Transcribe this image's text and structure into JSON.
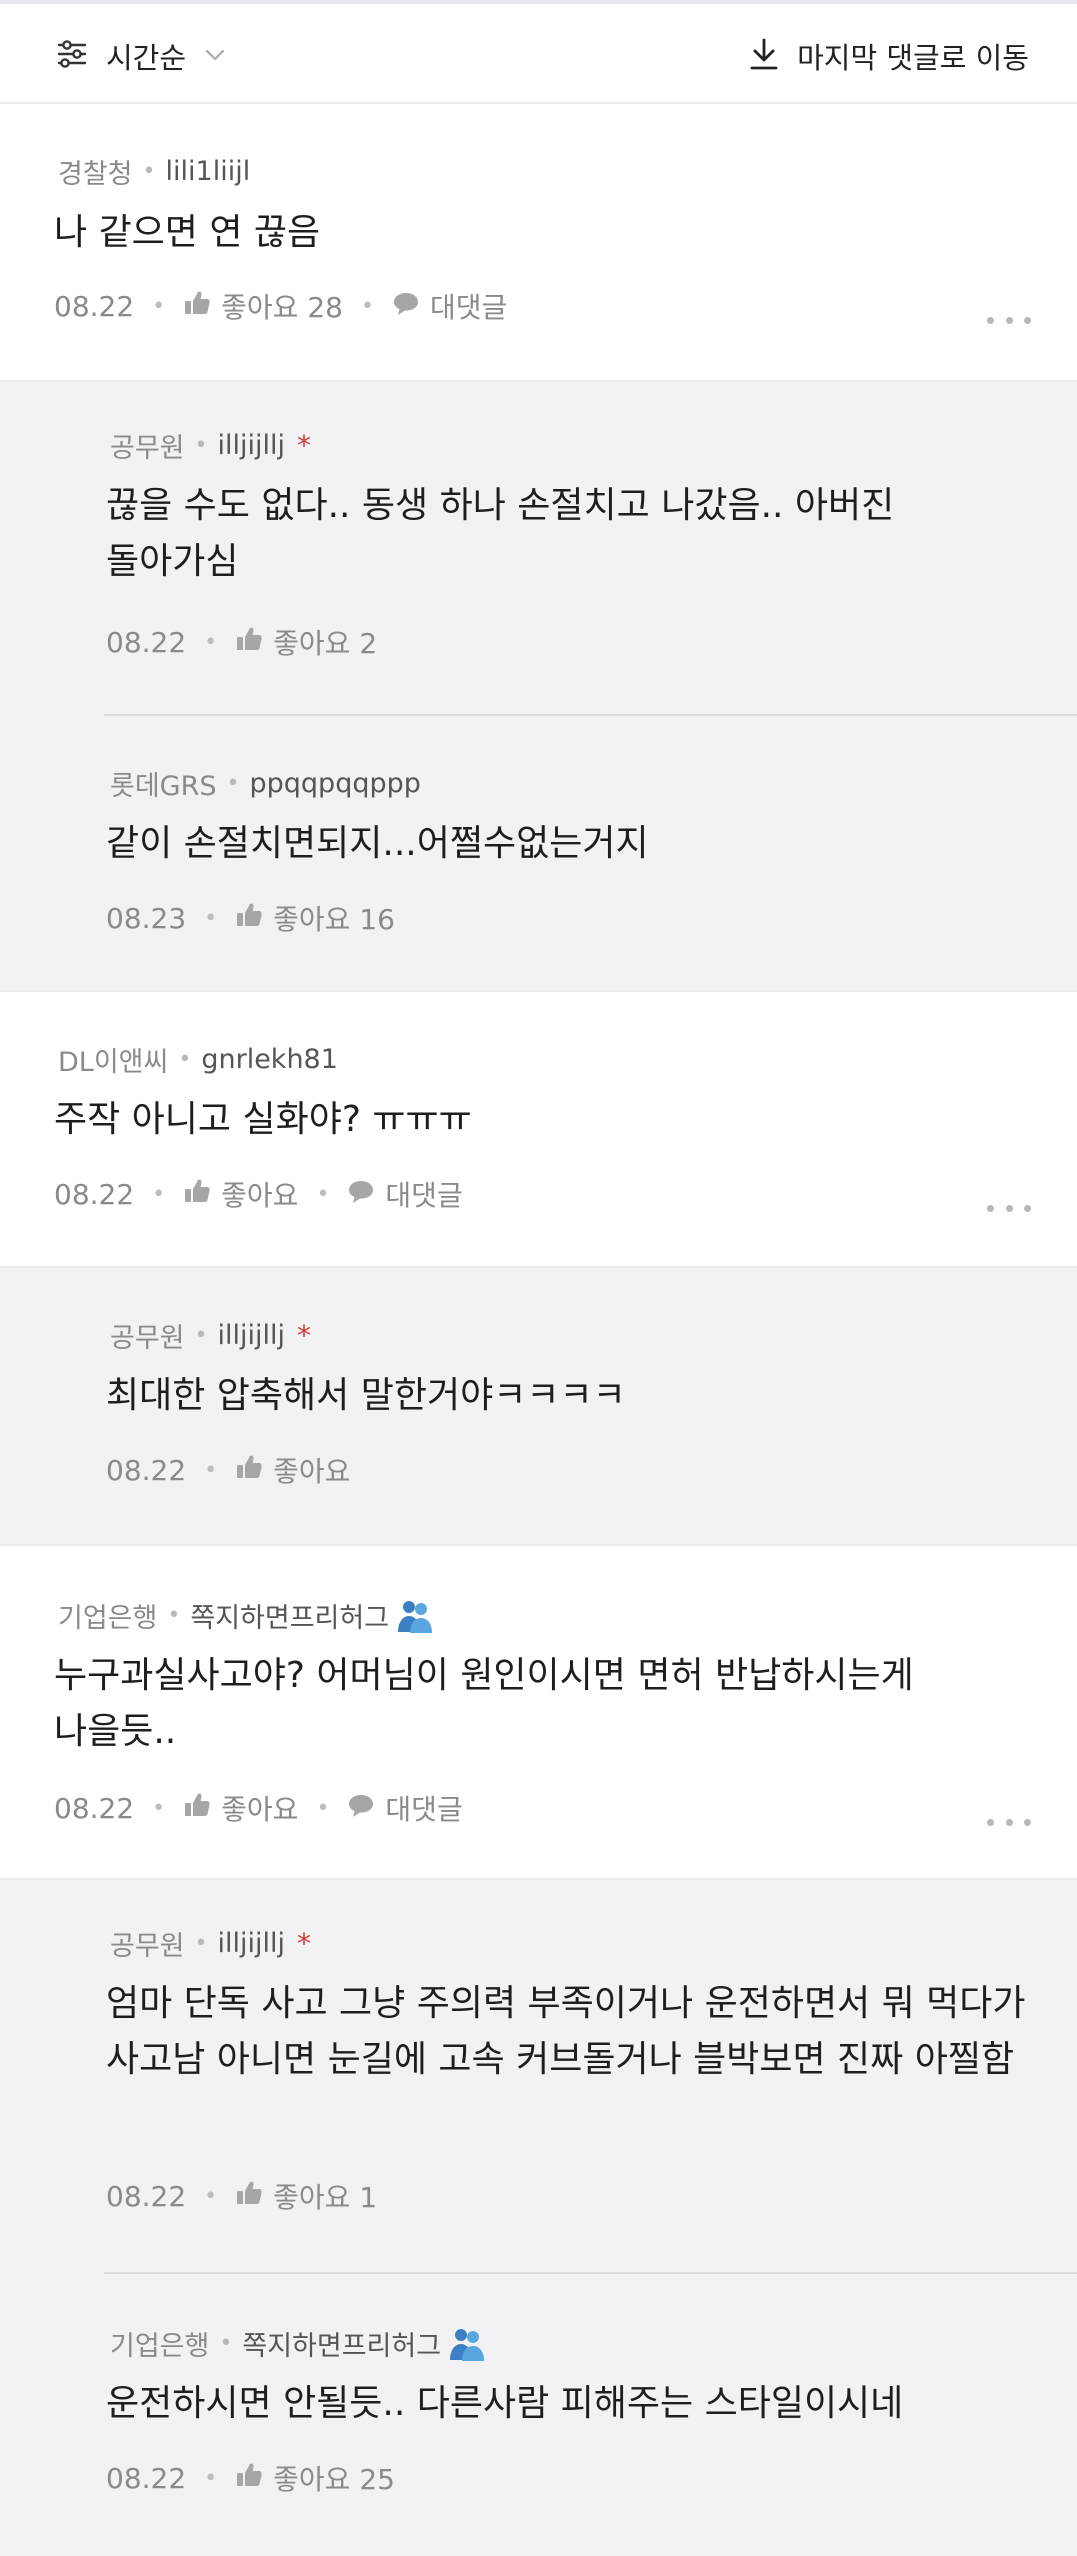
{
  "toolbar": {
    "sort_label": "시간순",
    "jump_label": "마지막 댓글로 이동"
  },
  "comments": [
    {
      "company": "경찰청",
      "nick": "lili1liijl",
      "text": "나 같으면 연 끊음",
      "date": "08.22",
      "likes_label": "좋아요 28",
      "reply_label": "대댓글"
    },
    {
      "company": "공무원",
      "nick": "illjijllj",
      "author_mark": "*",
      "text": "끊을 수도 없다.. 동생 하나 손절치고 나갔음.. 아버진 돌아가심",
      "date": "08.22",
      "likes_label": "좋아요 2"
    },
    {
      "company": "롯데GRS",
      "nick": "ppqqpqqppp",
      "text": "같이 손절치면되지...어쩔수없는거지",
      "date": "08.23",
      "likes_label": "좋아요 16"
    },
    {
      "company": "DL이앤씨",
      "nick": "gnrlekh81",
      "text": "주작 아니고 실화야? ㅠㅠㅠ",
      "date": "08.22",
      "likes_label": "좋아요",
      "reply_label": "대댓글"
    },
    {
      "company": "공무원",
      "nick": "illjijllj",
      "author_mark": "*",
      "text": "최대한 압축해서 말한거야ㅋㅋㅋㅋ",
      "date": "08.22",
      "likes_label": "좋아요"
    },
    {
      "company": "기업은행",
      "nick": "쪽지하면프리허그",
      "text": "누구과실사고야? 어머님이 원인이시면 면허 반납하시는게 나을듯..",
      "date": "08.22",
      "likes_label": "좋아요",
      "reply_label": "대댓글"
    },
    {
      "company": "공무원",
      "nick": "illjijllj",
      "author_mark": "*",
      "text": "엄마 단독 사고 그냥 주의력 부족이거나 운전하면서 뭐 먹다가 사고남 아니면 눈길에 고속 커브돌거나 블박보면 진짜 아찔함",
      "date": "08.22",
      "likes_label": "좋아요 1"
    },
    {
      "company": "기업은행",
      "nick": "쪽지하면프리허그",
      "text": "운전하시면 안될듯.. 다른사람 피해주는 스타일이시네",
      "date": "08.22",
      "likes_label": "좋아요 25"
    }
  ],
  "colors": {
    "reply_bg": "#f2f2f4",
    "author_mark": "#d83b3b",
    "muted_text": "#8a8a8a"
  }
}
